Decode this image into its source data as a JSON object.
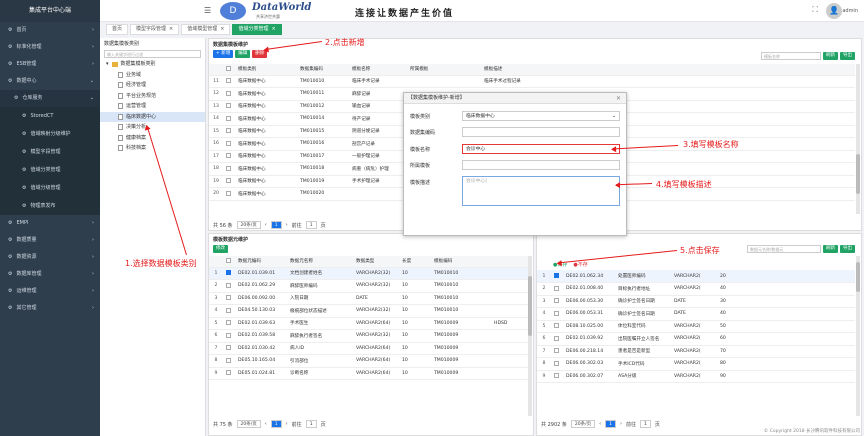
{
  "sidebar": {
    "title": "集成平台中心端",
    "items": [
      {
        "label": "首页",
        "level": 0
      },
      {
        "label": "标准化管理",
        "level": 0
      },
      {
        "label": "ESB管理",
        "level": 0
      },
      {
        "label": "数据中心",
        "level": 0,
        "active_parent": true
      },
      {
        "label": "仓库服务",
        "level": 1
      },
      {
        "label": "StoredCT",
        "level": 2
      },
      {
        "label": "值域映射分级维护",
        "level": 2
      },
      {
        "label": "模型字段管理",
        "level": 2
      },
      {
        "label": "值域分类管理",
        "level": 2
      },
      {
        "label": "值域分级管理",
        "level": 2
      },
      {
        "label": "物理表发布",
        "level": 2
      },
      {
        "label": "EMPI",
        "level": 0
      },
      {
        "label": "数据质量",
        "level": 0
      },
      {
        "label": "数据资源",
        "level": 0
      },
      {
        "label": "数据库管理",
        "level": 0
      },
      {
        "label": "运维管理",
        "level": 0
      },
      {
        "label": "其它管理",
        "level": 0
      }
    ]
  },
  "header": {
    "logo_text": "DataWorld",
    "logo_sub": "共享济世共惠",
    "slogan": "连接让数据产生价值",
    "logo_glyph": "D",
    "fullscreen_icon": "⛶",
    "user_icon": "👤",
    "user_name": "admin"
  },
  "tabs": [
    {
      "label": "首页",
      "active": false
    },
    {
      "label": "模型字段管理",
      "active": false
    },
    {
      "label": "值域模型管理",
      "active": false
    },
    {
      "label": "值域分类管理",
      "active": true
    }
  ],
  "tree": {
    "title": "数据集模板类别",
    "search_placeholder": "输入关键字进行过滤",
    "root": "数据集模板类别",
    "nodes": [
      "业务域",
      "经济管理",
      "平台业务规范",
      "运营管理",
      "临床数据中心",
      "决策分析",
      "健康档案",
      "科技档案"
    ],
    "selected_index": 4
  },
  "top_panel": {
    "title": "数据集模板维护",
    "buttons": {
      "add": "+ 新增",
      "edit": "编辑",
      "delete": "删除"
    },
    "search_placeholder": "模板名称",
    "right_buttons": {
      "refresh": "刷新",
      "export": "导出"
    },
    "columns": [
      "",
      "模板类别",
      "数据集编码",
      "模板名称",
      "所属模板",
      "",
      "模板描述"
    ],
    "rows": [
      [
        "11",
        "临床数据中心",
        "TM010010",
        "临床手术记录",
        "",
        "",
        "临床手术过程记录"
      ],
      [
        "12",
        "临床数据中心",
        "TM010011",
        "麻醉记录",
        "",
        "",
        ""
      ],
      [
        "13",
        "临床数据中心",
        "TM010012",
        "输血记录",
        "",
        "",
        ""
      ],
      [
        "14",
        "临床数据中心",
        "TM010014",
        "待产记录",
        "",
        "",
        ""
      ],
      [
        "15",
        "临床数据中心",
        "TM010015",
        "阴道分娩记录",
        "",
        "",
        ""
      ],
      [
        "16",
        "临床数据中心",
        "TM010016",
        "剖宫产记录",
        "",
        "",
        ""
      ],
      [
        "17",
        "临床数据中心",
        "TM010017",
        "一般护理记录",
        "",
        "",
        ""
      ],
      [
        "18",
        "临床数据中心",
        "TM010018",
        "病重（病危）护理",
        "",
        "",
        ""
      ],
      [
        "19",
        "临床数据中心",
        "TM010019",
        "手术护理记录",
        "",
        "",
        ""
      ],
      [
        "20",
        "临床数据中心",
        "TM010020",
        "",
        "",
        "",
        ""
      ]
    ],
    "pager": {
      "total": "共 56 条",
      "size": "20条/页",
      "goto": "前往",
      "page": "1",
      "unit": "页"
    }
  },
  "bottom_left_panel": {
    "title": "模板数据元维护",
    "button": "修改",
    "columns": [
      "",
      "数据元编码",
      "数据元名称",
      "数据类型",
      "长度",
      "",
      "模板编码",
      ""
    ],
    "rows": [
      [
        "1",
        "DE02.01.039.01",
        "文档创建者姓名",
        "VARCHAR2(32)",
        "10",
        "",
        "TM010010",
        ""
      ],
      [
        "2",
        "DE02.01.062.29",
        "麻醉医师编码",
        "VARCHAR2(32)",
        "10",
        "",
        "TM010010",
        ""
      ],
      [
        "3",
        "DE06.00.092.00",
        "入院日期",
        "DATE",
        "10",
        "",
        "TM010010",
        ""
      ],
      [
        "4",
        "DE04.50.130.03",
        "瘢痕部位状态描述",
        "VARCHAR2(32)",
        "10",
        "",
        "TM010010",
        ""
      ],
      [
        "5",
        "DE02.01.039.63",
        "手术医生",
        "VARCHAR2(64)",
        "10",
        "",
        "TM010009",
        "HDSD"
      ],
      [
        "6",
        "DE02.01.039.58",
        "麻醉执行者签名",
        "VARCHAR2(32)",
        "10",
        "",
        "TM010009",
        ""
      ],
      [
        "7",
        "DE02.01.030.42",
        "病人ID",
        "VARCHAR2(64)",
        "10",
        "",
        "TM010009",
        ""
      ],
      [
        "8",
        "DE05.10.165.04",
        "引流部位",
        "VARCHAR2(64)",
        "10",
        "",
        "TM010009",
        ""
      ],
      [
        "9",
        "DE05.01.024.81",
        "诊断名称",
        "VARCHAR2(64)",
        "10",
        "",
        "TM010009",
        ""
      ]
    ],
    "pager": {
      "total": "共 75 条",
      "size": "20条/页",
      "goto": "前往",
      "page": "1",
      "unit": "页"
    }
  },
  "bottom_right_panel": {
    "save_label": "保存",
    "cancel_label": "不存",
    "search_placeholder": "数据元名称/数据元",
    "right_buttons": {
      "refresh": "刷新",
      "export": "导出"
    },
    "columns": [
      "",
      "数据元编码",
      "名称",
      "数据元类型",
      "数据长度"
    ],
    "rows": [
      [
        "1",
        "DE02.01.062.34",
        "处置医师编码",
        "VARCHAR2(",
        "20"
      ],
      [
        "2",
        "DE02.01.008.40",
        "目标执行者地址",
        "VARCHAR2(",
        "40"
      ],
      [
        "3",
        "DE06.00.053.30",
        "确诊护士签名日期",
        "DATE",
        "30"
      ],
      [
        "4",
        "DE06.00.053.31",
        "确诊护士签名日期",
        "DATE",
        "40"
      ],
      [
        "5",
        "DE08.10.025.00",
        "体位科室代码",
        "VARCHAR2(",
        "50"
      ],
      [
        "6",
        "DE02.01.039.92",
        "出院医嘱开立人签名",
        "VARCHAR2(",
        "60"
      ],
      [
        "7",
        "DE06.00.218.14",
        "患者是否是新型",
        "VARCHAR2(",
        "70"
      ],
      [
        "8",
        "DE06.00.302.03",
        "手术ICD代码",
        "VARCHAR2(",
        "80"
      ],
      [
        "9",
        "DE06.00.302.07",
        "ASA分级",
        "VARCHAR2(",
        "90"
      ]
    ],
    "pager": {
      "total": "共 2902 条",
      "size": "20条/页",
      "goto": "前往",
      "page": "1",
      "unit": "页"
    }
  },
  "modal": {
    "title": "【数据集模板维护-新增】",
    "fields": {
      "category_label": "模板类别",
      "category_value": "临床数据中心",
      "code_label": "数据集编码",
      "code_value": "",
      "name_label": "模板名称",
      "name_value": "会诊中心",
      "template_label": "所属模板",
      "template_value": "",
      "desc_label": "模板描述",
      "desc_value": "会诊中心|"
    }
  },
  "annotations": {
    "a1": "1.选择数据模板类别",
    "a2": "2.点击新增",
    "a3": "3.填写模板名称",
    "a4": "4.填写模板描述",
    "a5": "5.点击保存"
  },
  "footer": {
    "copyright": "© Copyright 2018 长沙腾讯软件科技有限公司"
  }
}
